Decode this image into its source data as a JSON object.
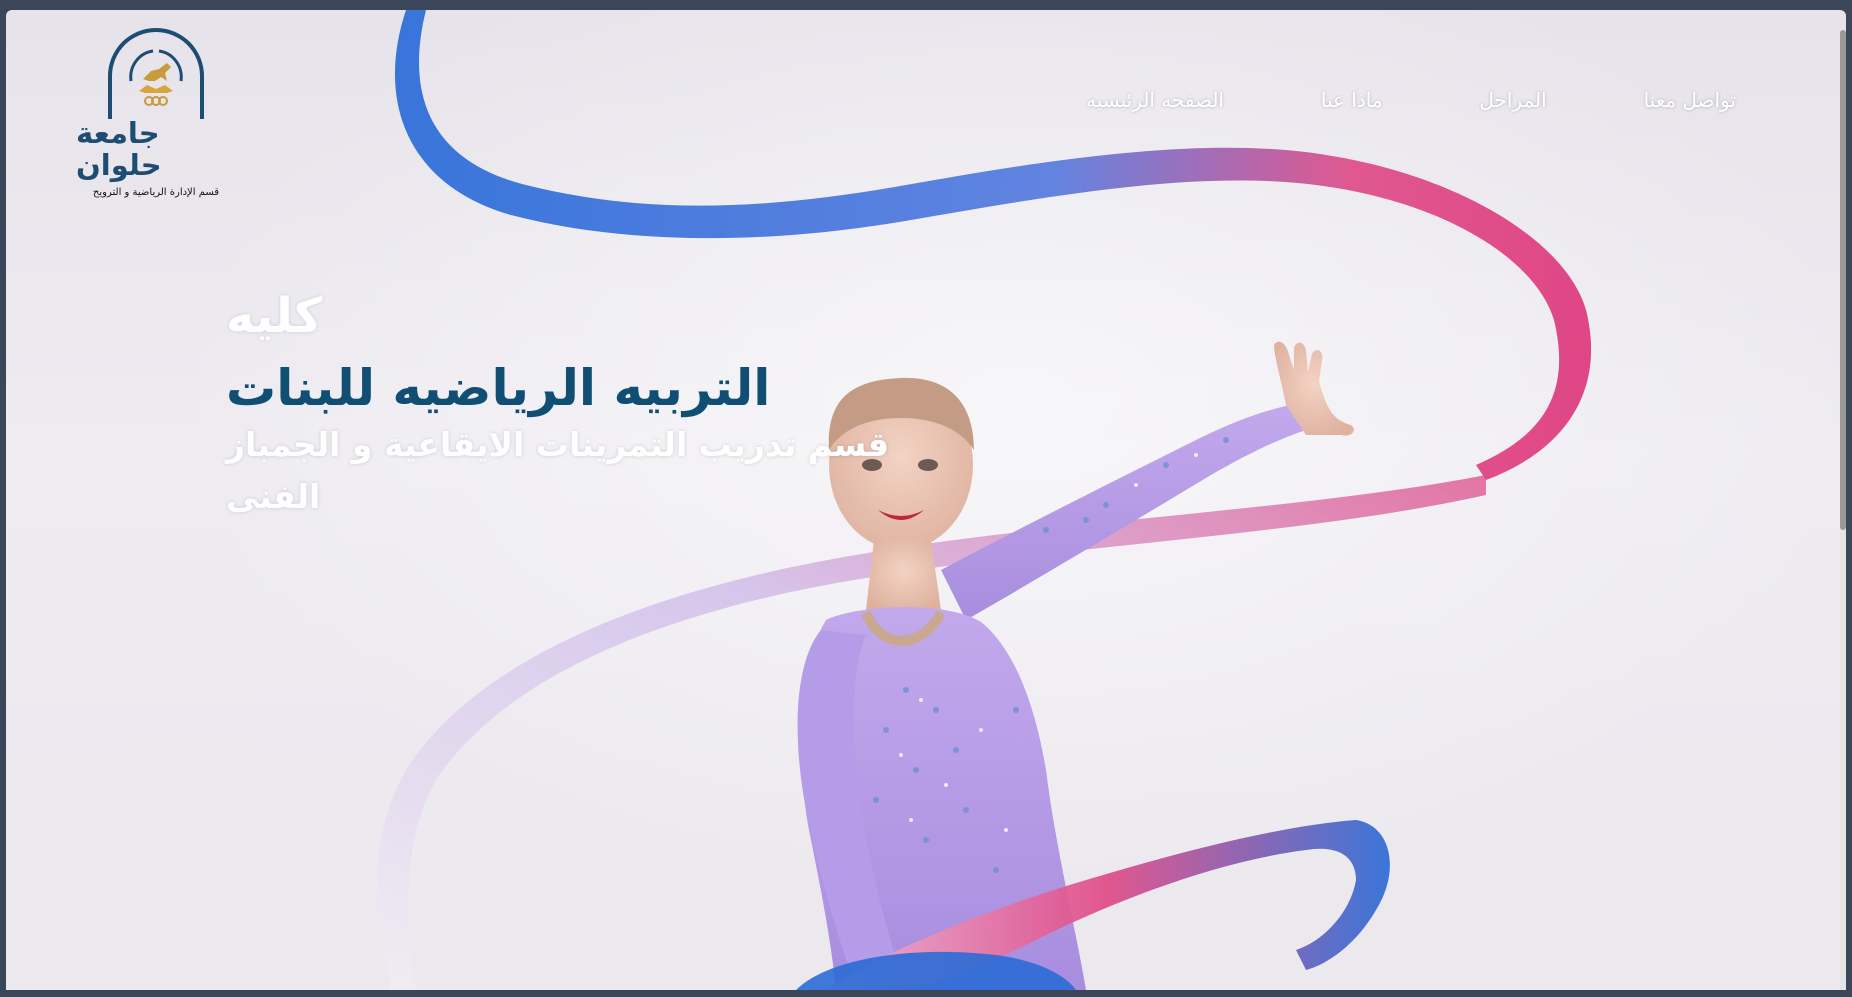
{
  "logo": {
    "name": "جامعة حلوان",
    "subtitle": "قسم الإدارة الرياضية و الترويح"
  },
  "nav": {
    "items": [
      {
        "label": "تواصل معنا"
      },
      {
        "label": "المراحل"
      },
      {
        "label": "ماذا عنا"
      },
      {
        "label": "الصفحه الرئيسيه"
      }
    ]
  },
  "hero": {
    "title": "كليه",
    "subtitle": "التربيه الرياضيه للبنات",
    "tagline": "قسم تدريب التمرينات الايقاعية و الجمباز الفنى"
  },
  "colors": {
    "brand": "#114e73",
    "ribbon_blue": "#2e6fd8",
    "ribbon_pink": "#e0407f",
    "leotard": "#b69be6"
  },
  "icons": {
    "logo_emblem": "university-emblem-icon"
  }
}
